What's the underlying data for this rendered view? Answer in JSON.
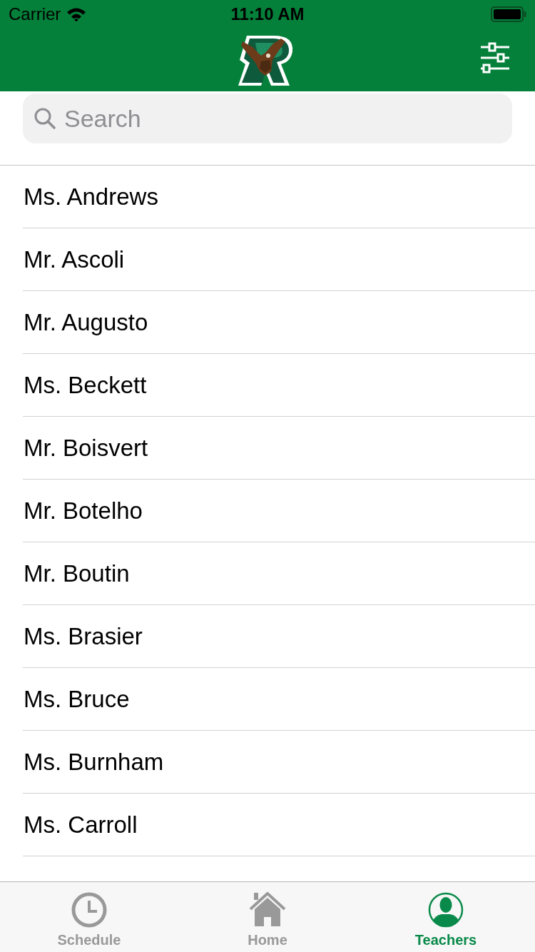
{
  "status_bar": {
    "carrier": "Carrier",
    "time": "11:10 AM"
  },
  "search": {
    "placeholder": "Search"
  },
  "teachers": [
    "Ms. Andrews",
    "Mr. Ascoli",
    "Mr. Augusto",
    "Ms. Beckett",
    "Mr. Boisvert",
    "Mr. Botelho",
    "Mr. Boutin",
    "Ms. Brasier",
    "Ms. Bruce",
    "Ms. Burnham",
    "Ms. Carroll"
  ],
  "tab_bar": [
    {
      "label": "Schedule",
      "kind": "clock",
      "selected": false
    },
    {
      "label": "Home",
      "kind": "home",
      "selected": false
    },
    {
      "label": "Teachers",
      "kind": "person",
      "selected": true
    }
  ]
}
